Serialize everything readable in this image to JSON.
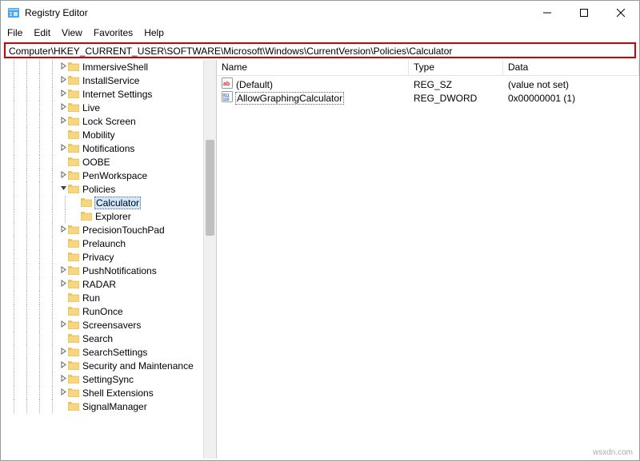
{
  "window": {
    "title": "Registry Editor"
  },
  "menu": {
    "file": "File",
    "edit": "Edit",
    "view": "View",
    "favorites": "Favorites",
    "help": "Help"
  },
  "address": {
    "path": "Computer\\HKEY_CURRENT_USER\\SOFTWARE\\Microsoft\\Windows\\CurrentVersion\\Policies\\Calculator"
  },
  "tree": {
    "items": [
      {
        "label": "ImmersiveShell",
        "depth": 3,
        "expander": ">"
      },
      {
        "label": "InstallService",
        "depth": 3,
        "expander": ">"
      },
      {
        "label": "Internet Settings",
        "depth": 3,
        "expander": ">"
      },
      {
        "label": "Live",
        "depth": 3,
        "expander": ">"
      },
      {
        "label": "Lock Screen",
        "depth": 3,
        "expander": ">"
      },
      {
        "label": "Mobility",
        "depth": 3,
        "expander": ""
      },
      {
        "label": "Notifications",
        "depth": 3,
        "expander": ">"
      },
      {
        "label": "OOBE",
        "depth": 3,
        "expander": ""
      },
      {
        "label": "PenWorkspace",
        "depth": 3,
        "expander": ">"
      },
      {
        "label": "Policies",
        "depth": 3,
        "expander": "v",
        "expanded": true
      },
      {
        "label": "Calculator",
        "depth": 4,
        "expander": "",
        "selected": true
      },
      {
        "label": "Explorer",
        "depth": 4,
        "expander": ""
      },
      {
        "label": "PrecisionTouchPad",
        "depth": 3,
        "expander": ">"
      },
      {
        "label": "Prelaunch",
        "depth": 3,
        "expander": ""
      },
      {
        "label": "Privacy",
        "depth": 3,
        "expander": ""
      },
      {
        "label": "PushNotifications",
        "depth": 3,
        "expander": ">"
      },
      {
        "label": "RADAR",
        "depth": 3,
        "expander": ">"
      },
      {
        "label": "Run",
        "depth": 3,
        "expander": ""
      },
      {
        "label": "RunOnce",
        "depth": 3,
        "expander": ""
      },
      {
        "label": "Screensavers",
        "depth": 3,
        "expander": ">"
      },
      {
        "label": "Search",
        "depth": 3,
        "expander": ""
      },
      {
        "label": "SearchSettings",
        "depth": 3,
        "expander": ">"
      },
      {
        "label": "Security and Maintenance",
        "depth": 3,
        "expander": ">"
      },
      {
        "label": "SettingSync",
        "depth": 3,
        "expander": ">"
      },
      {
        "label": "Shell Extensions",
        "depth": 3,
        "expander": ">"
      },
      {
        "label": "SignalManager",
        "depth": 3,
        "expander": ""
      }
    ]
  },
  "list": {
    "columns": {
      "name": "Name",
      "type": "Type",
      "data": "Data"
    },
    "rows": [
      {
        "icon": "string",
        "name": "(Default)",
        "type": "REG_SZ",
        "data": "(value not set)",
        "selected": false
      },
      {
        "icon": "dword",
        "name": "AllowGraphingCalculator",
        "type": "REG_DWORD",
        "data": "0x00000001 (1)",
        "selected": true
      }
    ]
  },
  "watermark": "wsxdn.com"
}
